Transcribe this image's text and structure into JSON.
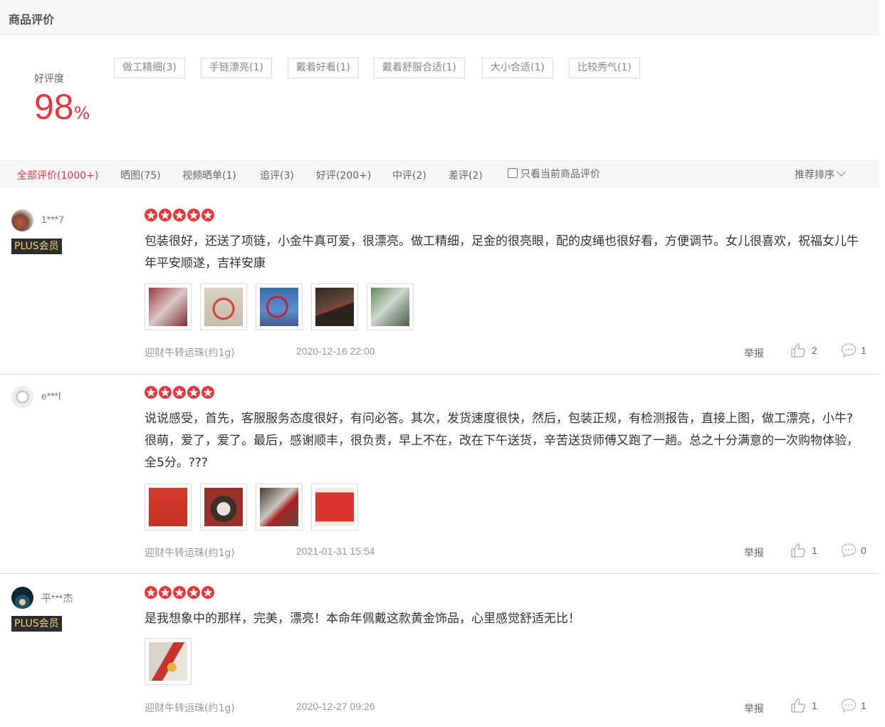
{
  "section_title": "商品评价",
  "rating": {
    "label": "好评度",
    "value": "98",
    "unit": "%"
  },
  "tags": [
    "做工精细(3)",
    "手链漂亮(1)",
    "戴着好看(1)",
    "戴着舒服合适(1)",
    "大小合适(1)",
    "比较秀气(1)"
  ],
  "filters": {
    "all": "全部评价(1000+)",
    "photos": "晒图(75)",
    "video": "视频晒单(1)",
    "followup": "追评(3)",
    "good": "好评(200+)",
    "neutral": "中评(2)",
    "bad": "差评(2)",
    "current_only": "只看当前商品评价",
    "sort": "推荐排序"
  },
  "accent_color": "#e4393c",
  "reviews": [
    {
      "user": "1***7",
      "badge": "PLUS会员",
      "stars": 5,
      "text": "包装很好，还送了项链，小金牛真可爱，很漂亮。做工精细，足金的很亮眼，配的皮绳也很好看，方便调节。女儿很喜欢，祝福女儿牛年平安顺遂，吉祥安康",
      "variant": "迎财牛转运珠(约1g)",
      "date": "2020-12-16 22:00",
      "report": "举报",
      "likes": "2",
      "replies": "1"
    },
    {
      "user": "e***l",
      "badge": "",
      "stars": 5,
      "text": "说说感受，首先，客服服务态度很好，有问必答。其次，发货速度很快，然后，包装正规，有检测报告，直接上图，做工漂亮，小牛?很萌，爱了，爱了。最后，感谢顺丰，很负责，早上不在，改在下午送货，辛苦送货师傅又跑了一趟。总之十分满意的一次购物体验，全5分。???",
      "variant": "迎财牛转运珠(约1g)",
      "date": "2021-01-31 15:54",
      "report": "举报",
      "likes": "1",
      "replies": "0"
    },
    {
      "user": "平***杰",
      "badge": "PLUS会员",
      "stars": 5,
      "text": "是我想象中的那样，完美，漂亮！本命年佩戴这款黄金饰品，心里感觉舒适无比！",
      "variant": "迎财牛转运珠(约1g)",
      "date": "2020-12-27 09:26",
      "report": "举报",
      "likes": "1",
      "replies": "1"
    }
  ]
}
